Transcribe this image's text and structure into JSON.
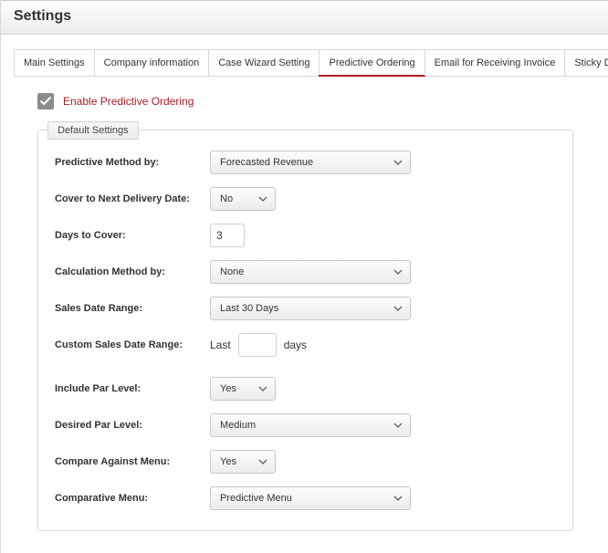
{
  "header": {
    "title": "Settings"
  },
  "tabs": [
    {
      "label": "Main Settings"
    },
    {
      "label": "Company information"
    },
    {
      "label": "Case Wizard Setting"
    },
    {
      "label": "Predictive Ordering"
    },
    {
      "label": "Email for Receiving Invoice"
    },
    {
      "label": "Sticky Dates Integration"
    }
  ],
  "enable": {
    "checked": true,
    "label": "Enable Predictive Ordering"
  },
  "fieldset": {
    "legend": "Default Settings"
  },
  "fields": {
    "predictive_method": {
      "label": "Predictive Method by:",
      "value": "Forecasted Revenue"
    },
    "cover_next_delivery": {
      "label": "Cover to Next Delivery Date:",
      "value": "No"
    },
    "days_to_cover": {
      "label": "Days to Cover:",
      "value": "3"
    },
    "calc_method": {
      "label": "Calculation Method by:",
      "value": "None"
    },
    "sales_date_range": {
      "label": "Sales Date Range:",
      "value": "Last 30 Days"
    },
    "custom_sales_range": {
      "label": "Custom Sales Date Range:",
      "prefix": "Last",
      "value": "",
      "suffix": "days"
    },
    "include_par": {
      "label": "Include Par Level:",
      "value": "Yes"
    },
    "desired_par": {
      "label": "Desired Par Level:",
      "value": "Medium"
    },
    "compare_menu": {
      "label": "Compare Against Menu:",
      "value": "Yes"
    },
    "comparative_menu": {
      "label": "Comparative Menu:",
      "value": "Predictive Menu"
    }
  }
}
